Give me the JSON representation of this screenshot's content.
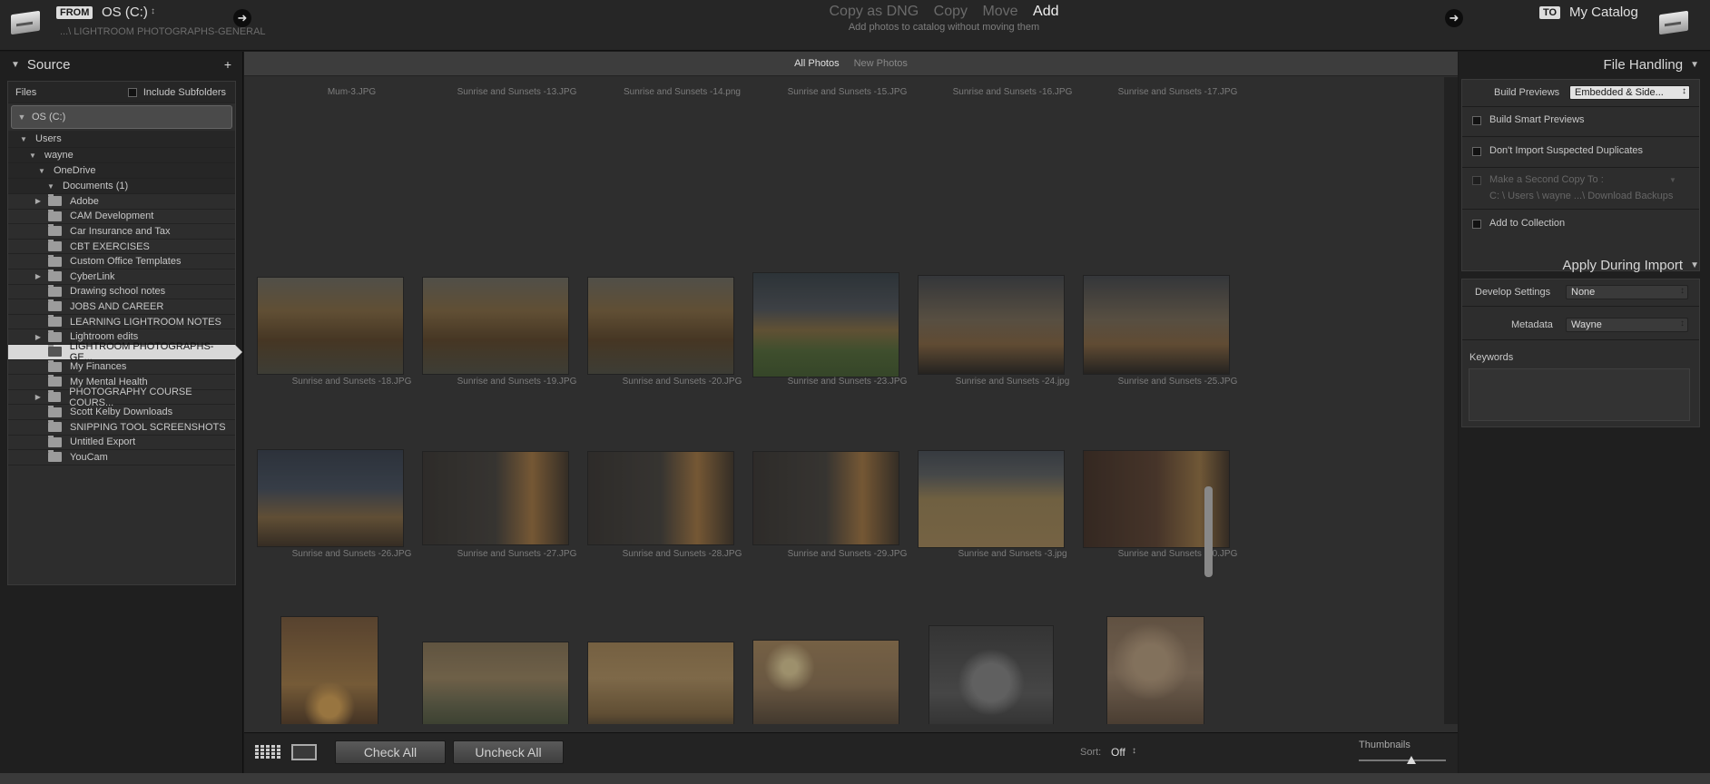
{
  "header": {
    "from_tag": "FROM",
    "source_drive": "OS (C:)",
    "source_path": "...\\ LIGHTROOM PHOTOGRAPHS-GENERAL",
    "modes": [
      "Copy as DNG",
      "Copy",
      "Move",
      "Add"
    ],
    "active_mode": "Add",
    "subtitle": "Add photos to catalog without moving them",
    "to_tag": "TO",
    "catalog": "My Catalog"
  },
  "source": {
    "title": "Source",
    "files_label": "Files",
    "include_subfolders": "Include Subfolders",
    "drive": "OS (C:)",
    "tree": [
      {
        "label": "Users",
        "level": 0,
        "exp": "open"
      },
      {
        "label": "wayne",
        "level": 1,
        "exp": "open"
      },
      {
        "label": "OneDrive",
        "level": 2,
        "exp": "open"
      },
      {
        "label": "Documents (1)",
        "level": 3,
        "exp": "open"
      }
    ],
    "folders": [
      {
        "label": "Adobe",
        "exp": true
      },
      {
        "label": "CAM Development",
        "exp": false
      },
      {
        "label": "Car Insurance and Tax",
        "exp": false
      },
      {
        "label": "CBT EXERCISES",
        "exp": false
      },
      {
        "label": "Custom Office Templates",
        "exp": false
      },
      {
        "label": "CyberLink",
        "exp": true
      },
      {
        "label": "Drawing school notes",
        "exp": false
      },
      {
        "label": "JOBS AND CAREER",
        "exp": false
      },
      {
        "label": "LEARNING LIGHTROOM NOTES",
        "exp": false
      },
      {
        "label": "Lightroom edits",
        "exp": true
      },
      {
        "label": "LIGHTROOM PHOTOGRAPHS-GE...",
        "exp": false,
        "selected": true
      },
      {
        "label": "My Finances",
        "exp": false
      },
      {
        "label": "My Mental Health",
        "exp": false
      },
      {
        "label": "PHOTOGRAPHY COURSE COURS...",
        "exp": true
      },
      {
        "label": "Scott Kelby Downloads",
        "exp": false
      },
      {
        "label": "SNIPPING TOOL SCREENSHOTS",
        "exp": false
      },
      {
        "label": "Untitled Export",
        "exp": false
      },
      {
        "label": "YouCam",
        "exp": false
      }
    ]
  },
  "tabs": {
    "all": "All Photos",
    "new": "New Photos"
  },
  "photos": [
    {
      "caption": "Mum-3.JPG",
      "tone": "portrait-top"
    },
    {
      "caption": "Sunrise and Sunsets -13.JPG",
      "tone": "blank"
    },
    {
      "caption": "Sunrise and Sunsets -14.png",
      "tone": "sunset-top"
    },
    {
      "caption": "Sunrise and Sunsets -15.JPG",
      "tone": "sunset-top"
    },
    {
      "caption": "Sunrise and Sunsets -16.JPG",
      "tone": "bokeh-top"
    },
    {
      "caption": "Sunrise and Sunsets -17.JPG",
      "tone": "sunset-top"
    },
    {
      "caption": "Sunrise and Sunsets -18.JPG",
      "tone": "autumn"
    },
    {
      "caption": "Sunrise and Sunsets -19.JPG",
      "tone": "autumn"
    },
    {
      "caption": "Sunrise and Sunsets -20.JPG",
      "tone": "autumn"
    },
    {
      "caption": "Sunrise and Sunsets -23.JPG",
      "tone": "green"
    },
    {
      "caption": "Sunrise and Sunsets -24.jpg",
      "tone": "tree-sky"
    },
    {
      "caption": "Sunrise and Sunsets -25.JPG",
      "tone": "tree-sky"
    },
    {
      "caption": "Sunrise and Sunsets -26.JPG",
      "tone": "barn-blue"
    },
    {
      "caption": "Sunrise and Sunsets -27.JPG",
      "tone": "barn-dusk"
    },
    {
      "caption": "Sunrise and Sunsets -28.JPG",
      "tone": "barn-dusk"
    },
    {
      "caption": "Sunrise and Sunsets -29.JPG",
      "tone": "barn-dusk"
    },
    {
      "caption": "Sunrise and Sunsets -3.jpg",
      "tone": "field"
    },
    {
      "caption": "Sunrise and Sunsets -30.JPG",
      "tone": "barn-dark"
    },
    {
      "caption": "",
      "tone": "sun-portrait"
    },
    {
      "caption": "",
      "tone": "misty"
    },
    {
      "caption": "",
      "tone": "golden"
    },
    {
      "caption": "",
      "tone": "poles"
    },
    {
      "caption": "",
      "tone": "boy"
    },
    {
      "caption": "",
      "tone": "sepia"
    }
  ],
  "bottom": {
    "check_all": "Check All",
    "uncheck_all": "Uncheck All",
    "sort_label": "Sort:",
    "sort_value": "Off",
    "thumbnails_label": "Thumbnails",
    "thumbnail_size": 0.6
  },
  "file_handling": {
    "title": "File Handling",
    "build_previews_label": "Build Previews",
    "build_previews_value": "Embedded & Side...",
    "smart_previews": "Build Smart Previews",
    "no_duplicates": "Don't Import Suspected Duplicates",
    "second_copy": "Make a Second Copy To :",
    "second_copy_path": "C: \\ Users \\ wayne ...\\ Download Backups",
    "add_collection": "Add to Collection"
  },
  "apply_during_import": {
    "title": "Apply During Import",
    "develop_label": "Develop Settings",
    "develop_value": "None",
    "metadata_label": "Metadata",
    "metadata_value": "Wayne",
    "keywords_label": "Keywords"
  }
}
